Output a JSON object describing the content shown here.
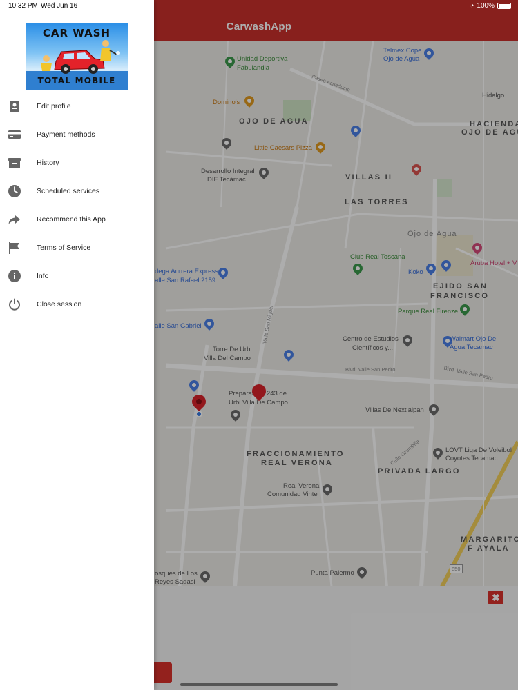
{
  "status_bar": {
    "time": "10:32 PM",
    "date": "Wed Jun 16",
    "battery": "100%"
  },
  "app": {
    "title": "CarwashApp",
    "accent_color": "#c9302c"
  },
  "drawer": {
    "logo": {
      "top_text": "CAR WASH",
      "bottom_text": "TOTAL MOBILE"
    },
    "menu_items": [
      {
        "label": "Edit profile",
        "icon": "profile-card-icon"
      },
      {
        "label": "Payment methods",
        "icon": "credit-card-icon"
      },
      {
        "label": "History",
        "icon": "archive-box-icon"
      },
      {
        "label": "Scheduled services",
        "icon": "clock-icon"
      },
      {
        "label": "Recommend this App",
        "icon": "share-arrow-icon"
      },
      {
        "label": "Terms of Service",
        "icon": "flag-icon"
      },
      {
        "label": "Info",
        "icon": "info-icon"
      },
      {
        "label": "Close session",
        "icon": "power-icon"
      }
    ]
  },
  "map": {
    "areas": {
      "ojo_de_agua": "OJO DE AGUA",
      "villas_ii": "VILLAS II",
      "las_torres": "LAS TORRES",
      "hacienda": "HACIENDA",
      "hacienda2": "OJO DE AGUA",
      "ojo_de_agua_light": "Ojo de Agua",
      "ejido": "EJIDO SAN",
      "ejido2": "FRANCISCO",
      "fraccionamiento": "FRACCIONAMIENTO",
      "real_verona_area": "REAL VERONA",
      "privada_largo": "PRIVADA LARGO",
      "margarito": "MARGARITO",
      "margarito2": "F AYALA"
    },
    "places": {
      "unidad_deportiva": "Unidad Deportiva",
      "fabulandia": "Fabulandia",
      "telmex": "Telmex Cope",
      "telmex2": "Ojo de Agua",
      "dominos": "Domino's",
      "little_caesars": "Little Caesars Pizza",
      "desarrollo": "Desarrollo Integral",
      "desarrollo2": "DIF Tecámac",
      "club_real": "Club Real Toscana",
      "koko": "Koko",
      "aruba": "Aruba Hotel + V",
      "bodega": "dega Aurrera Express",
      "bodega2": "alle San Rafael 2159",
      "parque": "Parque Real Firenze",
      "valle_gabriel": "alle San Gabriel",
      "centro": "Centro de Estudios",
      "centro2": "Científicos y...",
      "walmart": "Walmart Ojo De",
      "walmart2": "Agua Tecamac",
      "torre": "Torre De Urbi",
      "torre2": "Villa Del Campo",
      "preparatoria": "Preparatoria 243 de",
      "preparatoria2": "Urbi Villa De Campo",
      "villas_nextlalpan": "Villas De Nextlalpan",
      "lovt": "LOVT Liga De Voleibol",
      "lovt2": "Coyotes Tecamac",
      "real_verona": "Real Verona",
      "real_verona2": "Comunidad Vinte",
      "bosques": "osques de Los",
      "bosques2": "Reyes Sadasi",
      "punta_palermo": "Punta Palermo",
      "hidalgo": "Hidalgo"
    },
    "streets": {
      "blvd_valle_san_pedro": "Blvd. Valle San Pedro",
      "blvd_valle_san_pedro2": "Blvd. Valle San Pedro",
      "valle_san_miguel": "Valle San Miguel",
      "paseo_acueducto": "Paseo Acueducto",
      "calle_ozumbilla": "Calle Ozumbilla",
      "route": "850"
    }
  },
  "panel": {
    "close_symbol": "✖"
  }
}
